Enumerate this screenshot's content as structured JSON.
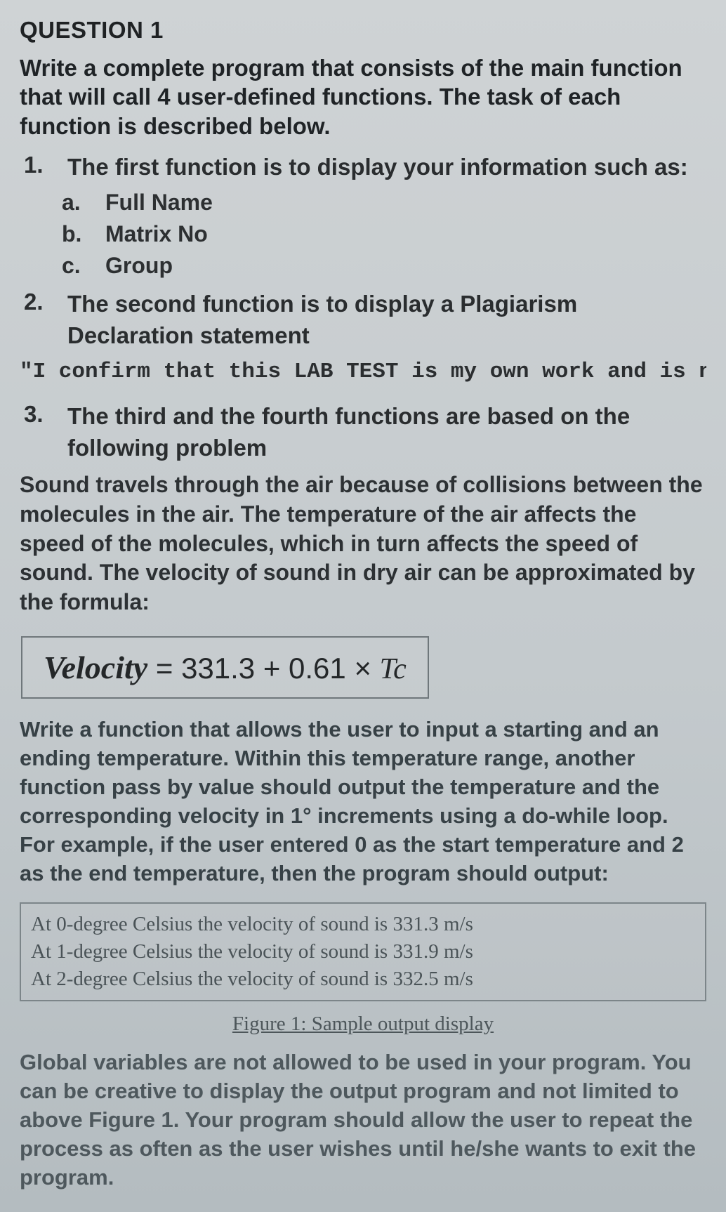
{
  "title": "QUESTION 1",
  "intro": "Write a complete program that consists of the main function that will call 4 user-defined functions. The task of each function is described below.",
  "items": [
    {
      "num": "1.",
      "text": "The first function is to display your information such as:"
    }
  ],
  "sub_items": [
    {
      "letter": "a.",
      "text": "Full Name"
    },
    {
      "letter": "b.",
      "text": "Matrix No"
    },
    {
      "letter": "c.",
      "text": "Group"
    }
  ],
  "item2": {
    "num": "2.",
    "text": "The second function is to display a Plagiarism Declaration statement"
  },
  "declaration": "\"I confirm that this LAB TEST is my own work and is not copied from",
  "item3": {
    "num": "3.",
    "text": "The third and the fourth functions are based on the following problem"
  },
  "para_sound": "Sound travels through the air because of collisions between the molecules in the air. The temperature of the air affects the speed of the molecules, which in turn affects the speed of sound. The velocity of sound in dry air can be approximated by the formula:",
  "formula": {
    "lhs": "Velocity",
    "eq": " = ",
    "rhs_a": "331.3 + 0.61 × ",
    "rhs_tc": "Tc"
  },
  "para_instruct": "Write a function that allows the user to input a starting and an ending temperature. Within this temperature range, another function pass by value should output the temperature and the corresponding velocity in 1° increments using a do-while loop. For example, if the user entered 0 as the start temperature and 2 as the end temperature, then the program should output:",
  "output": [
    "At 0-degree Celsius the velocity of sound is 331.3 m/s",
    "At 1-degree Celsius the velocity of sound is 331.9 m/s",
    "At 2-degree Celsius the velocity of sound is 332.5 m/s"
  ],
  "fig_caption": "Figure 1: Sample output display",
  "para_global": "Global variables are not allowed to be used in your program. You can be creative to display the output program and not limited to above Figure 1. Your program should allow the user to repeat the process as often as the user wishes until he/she wants to exit the program."
}
